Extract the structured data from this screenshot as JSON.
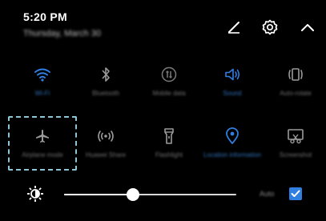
{
  "header": {
    "time": "5:20 PM",
    "date": "Thursday, March 30"
  },
  "tiles": [
    {
      "label": "Wi-Fi",
      "icon": "wifi-icon",
      "active": true
    },
    {
      "label": "Bluetooth",
      "icon": "bluetooth-icon",
      "active": false
    },
    {
      "label": "Mobile data",
      "icon": "mobile-data-icon",
      "active": false
    },
    {
      "label": "Sound",
      "icon": "sound-icon",
      "active": true
    },
    {
      "label": "Auto-rotate",
      "icon": "auto-rotate-icon",
      "active": false
    },
    {
      "label": "Airplane mode",
      "icon": "airplane-icon",
      "active": false
    },
    {
      "label": "Huawei Share",
      "icon": "huawei-share-icon",
      "active": false
    },
    {
      "label": "Flashlight",
      "icon": "flashlight-icon",
      "active": false
    },
    {
      "label": "Location information",
      "icon": "location-icon",
      "active": true
    },
    {
      "label": "Screenshot",
      "icon": "screenshot-icon",
      "active": false
    }
  ],
  "brightness": {
    "level": 0.4,
    "auto_label": "Auto",
    "auto_checked": true
  },
  "colors": {
    "active": "#2f7ee0",
    "inactive": "#8a8a8a",
    "highlight": "#8fc4d4"
  }
}
